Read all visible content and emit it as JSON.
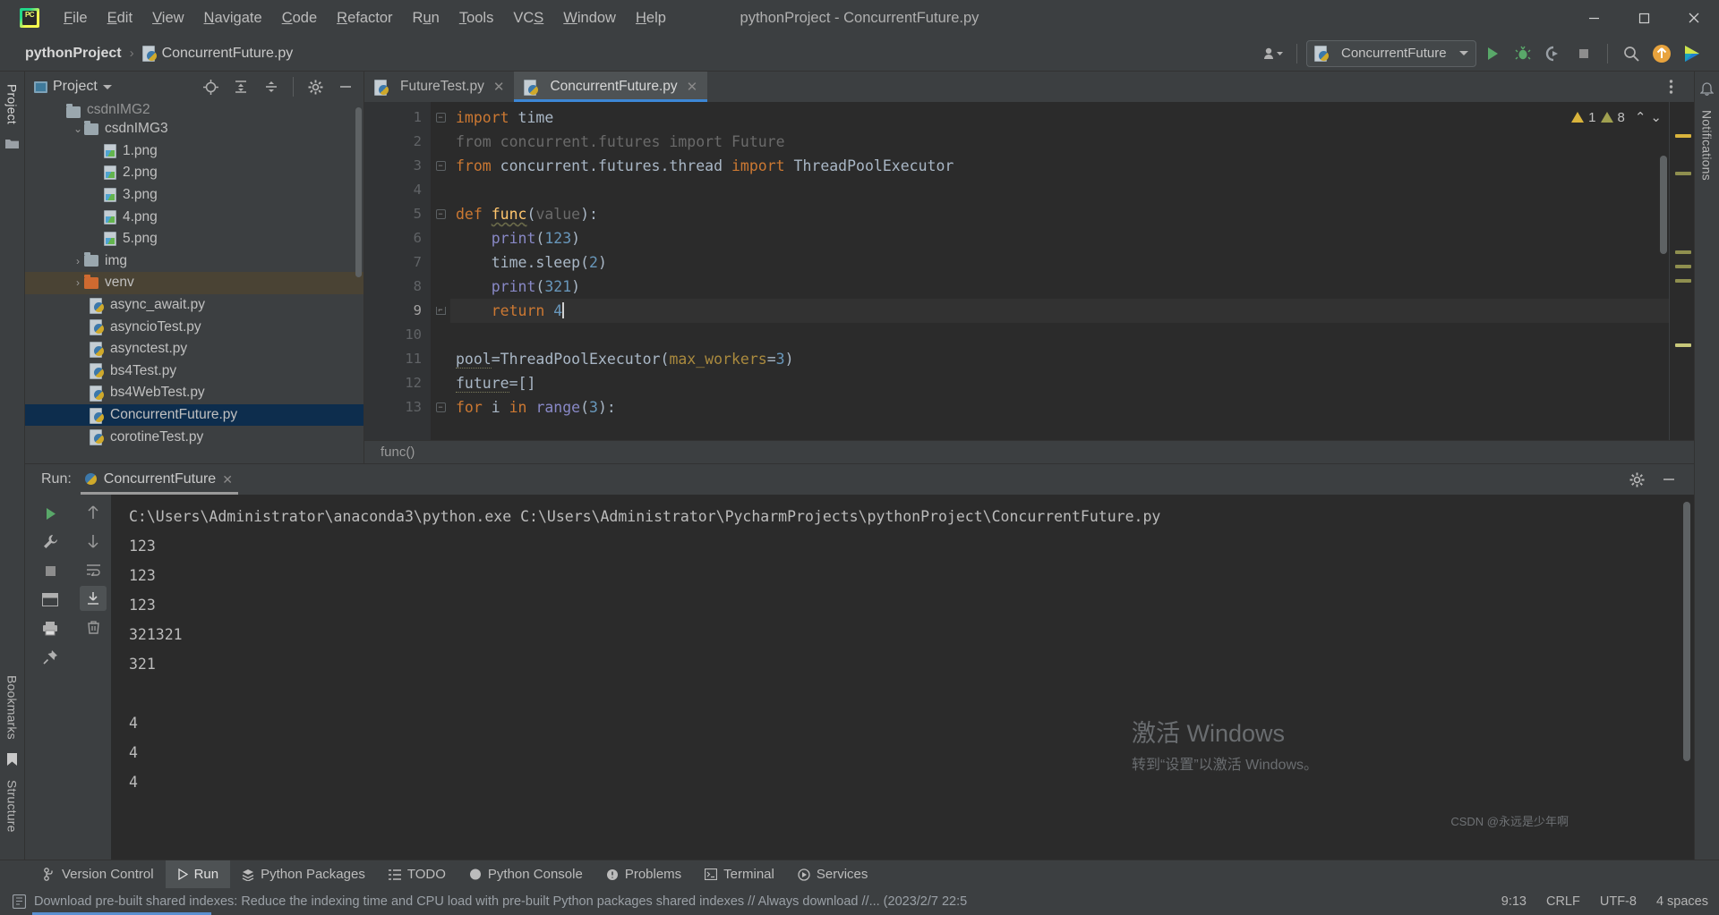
{
  "window": {
    "title": "pythonProject - ConcurrentFuture.py",
    "minimize": "–",
    "maximize": "▢",
    "close": "✕"
  },
  "menubar": {
    "items": [
      {
        "label": "File",
        "mnemonic": "F"
      },
      {
        "label": "Edit",
        "mnemonic": "E"
      },
      {
        "label": "View",
        "mnemonic": "V"
      },
      {
        "label": "Navigate",
        "mnemonic": "N"
      },
      {
        "label": "Code",
        "mnemonic": "C"
      },
      {
        "label": "Refactor",
        "mnemonic": "R"
      },
      {
        "label": "Run",
        "mnemonic": "u"
      },
      {
        "label": "Tools",
        "mnemonic": "T"
      },
      {
        "label": "VCS",
        "mnemonic": "S"
      },
      {
        "label": "Window",
        "mnemonic": "W"
      },
      {
        "label": "Help",
        "mnemonic": "H"
      }
    ]
  },
  "navbar": {
    "project_crumb": "pythonProject",
    "separator": "›",
    "file_crumb": "ConcurrentFuture.py",
    "run_config": "ConcurrentFuture",
    "icons": [
      "account-icon",
      "run-icon",
      "debug-icon",
      "run-coverage-icon",
      "stop-icon",
      "search-icon",
      "update-icon",
      "ide-features-icon"
    ]
  },
  "left_strip": {
    "project_label": "Project",
    "bookmarks_label": "Bookmarks",
    "structure_label": "Structure"
  },
  "right_strip": {
    "notifications_label": "Notifications"
  },
  "project_panel": {
    "title": "Project",
    "toolbar_icons": [
      "locate-icon",
      "expand-all-icon",
      "collapse-all-icon",
      "settings-icon",
      "hide-icon"
    ],
    "tree": [
      {
        "label": "csdnIMG2",
        "type": "folder",
        "indent": 1,
        "chevron": "⌄",
        "state": "clipped"
      },
      {
        "label": "csdnIMG3",
        "type": "folder",
        "indent": 1,
        "chevron": "⌄"
      },
      {
        "label": "1.png",
        "type": "image",
        "indent": 2
      },
      {
        "label": "2.png",
        "type": "image",
        "indent": 2
      },
      {
        "label": "3.png",
        "type": "image",
        "indent": 2
      },
      {
        "label": "4.png",
        "type": "image",
        "indent": 2
      },
      {
        "label": "5.png",
        "type": "image",
        "indent": 2
      },
      {
        "label": "img",
        "type": "folder",
        "indent": 1,
        "chevron": "›"
      },
      {
        "label": "venv",
        "type": "folder-orange",
        "indent": 1,
        "chevron": "›",
        "state": "hover"
      },
      {
        "label": "async_await.py",
        "type": "python",
        "indent": 2
      },
      {
        "label": "asyncioTest.py",
        "type": "python",
        "indent": 2
      },
      {
        "label": "asynctest.py",
        "type": "python",
        "indent": 2
      },
      {
        "label": "bs4Test.py",
        "type": "python",
        "indent": 2
      },
      {
        "label": "bs4WebTest.py",
        "type": "python",
        "indent": 2
      },
      {
        "label": "ConcurrentFuture.py",
        "type": "python",
        "indent": 2,
        "state": "selected"
      },
      {
        "label": "corotineTest.py",
        "type": "python",
        "indent": 2
      }
    ]
  },
  "editor": {
    "tabs": [
      {
        "label": "FutureTest.py",
        "active": false,
        "close": "✕"
      },
      {
        "label": "ConcurrentFuture.py",
        "active": true,
        "close": "✕"
      }
    ],
    "inspection": {
      "warning_count": "1",
      "weak_warning_count": "8",
      "up_arrow": "⌃",
      "down_arrow": "⌄"
    },
    "breadcrumb": "func()",
    "lines": [
      {
        "n": "1",
        "text": "import time"
      },
      {
        "n": "2",
        "text": "from concurrent.futures import Future"
      },
      {
        "n": "3",
        "text": "from concurrent.futures.thread import ThreadPoolExecutor"
      },
      {
        "n": "4",
        "text": ""
      },
      {
        "n": "5",
        "text": "def func(value):"
      },
      {
        "n": "6",
        "text": "    print(123)"
      },
      {
        "n": "7",
        "text": "    time.sleep(2)"
      },
      {
        "n": "8",
        "text": "    print(321)"
      },
      {
        "n": "9",
        "text": "    return 4",
        "current": true
      },
      {
        "n": "10",
        "text": ""
      },
      {
        "n": "11",
        "text": "pool=ThreadPoolExecutor(max_workers=3)"
      },
      {
        "n": "12",
        "text": "future=[]"
      },
      {
        "n": "13",
        "text": "for i in range(3):"
      }
    ]
  },
  "run_panel": {
    "label": "Run:",
    "tab": "ConcurrentFuture",
    "tab_close": "✕",
    "gutter_icons": [
      "rerun-icon",
      "up-stack-icon",
      "down-stack-icon",
      "wrench-icon",
      "stop-icon",
      "soft-wrap-icon",
      "scroll-to-end-icon",
      "print-icon",
      "pin-icon",
      "trash-icon"
    ],
    "header_icons": [
      "settings-icon",
      "hide-icon"
    ],
    "output": [
      "C:\\Users\\Administrator\\anaconda3\\python.exe C:\\Users\\Administrator\\PycharmProjects\\pythonProject\\ConcurrentFuture.py",
      "123",
      "123",
      "123",
      "321321",
      "321",
      "",
      "4",
      "4",
      "4"
    ]
  },
  "activation": {
    "line1": "激活 Windows",
    "line2": "转到“设置”以激活 Windows。"
  },
  "watermark": "CSDN @永远是少年啊",
  "tool_windows": [
    {
      "label": "Version Control",
      "icon": "branch-icon",
      "active": false
    },
    {
      "label": "Run",
      "icon": "play-icon",
      "active": true
    },
    {
      "label": "Python Packages",
      "icon": "packages-icon",
      "active": false
    },
    {
      "label": "TODO",
      "icon": "list-icon",
      "active": false
    },
    {
      "label": "Python Console",
      "icon": "python-icon",
      "active": false
    },
    {
      "label": "Problems",
      "icon": "problems-icon",
      "active": false
    },
    {
      "label": "Terminal",
      "icon": "terminal-icon",
      "active": false
    },
    {
      "label": "Services",
      "icon": "services-icon",
      "active": false
    }
  ],
  "statusbar": {
    "message": "Download pre-built shared indexes: Reduce the indexing time and CPU load with pre-built Python packages shared indexes // Always download //... (2023/2/7 22:5",
    "caret_position": "9:13",
    "line_separator": "CRLF",
    "encoding": "UTF-8",
    "indent": "4 spaces"
  },
  "colors": {
    "accent_blue": "#3d87d6",
    "selection_navy": "#0d2d4d",
    "hover_olive": "#4a4334",
    "keyword_orange": "#cc7832",
    "function_yellow": "#ffc66d",
    "number_blue": "#6897bb",
    "builtin_violet": "#8888c6",
    "editor_bg": "#2b2b2b",
    "panel_bg": "#3c3f41"
  }
}
